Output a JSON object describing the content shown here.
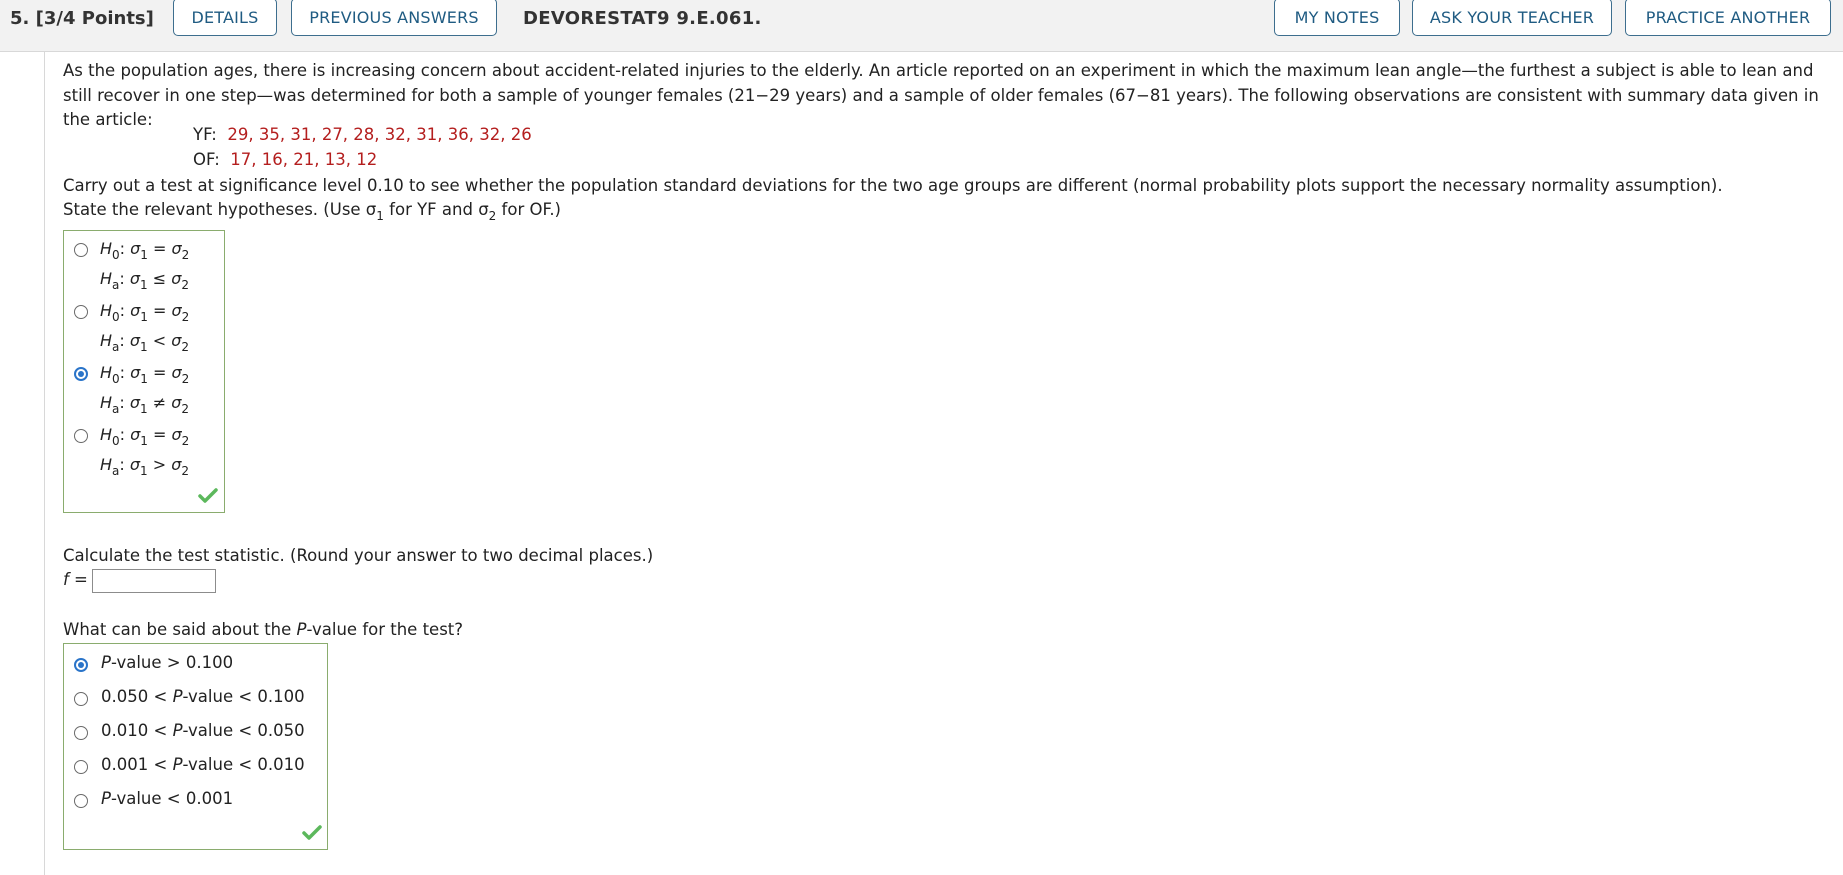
{
  "header": {
    "question_number": "5.",
    "points": "[3/4 Points]",
    "details_label": "DETAILS",
    "previous_answers_label": "PREVIOUS ANSWERS",
    "question_code": "DEVORESTAT9 9.E.061.",
    "my_notes_label": "MY NOTES",
    "ask_teacher_label": "ASK YOUR TEACHER",
    "practice_another_label": "PRACTICE ANOTHER"
  },
  "problem": {
    "intro": "As the population ages, there is increasing concern about accident-related injuries to the elderly. An article reported on an experiment in which the maximum lean angle—the furthest a subject is able to lean and still recover in one step—was determined for both a sample of younger females (21−29 years) and a sample of older females (67−81 years). The following observations are consistent with summary data given in the article:",
    "yf_label": "YF:",
    "yf_values": "29, 35, 31, 27, 28, 32, 31, 36, 32, 26",
    "of_label": "OF:",
    "of_values": "17, 16, 21, 13, 12",
    "test_instruction": "Carry out a test at significance level 0.10 to see whether the population standard deviations for the two age groups are different (normal probability plots support the necessary normality assumption).",
    "hypotheses_prompt_a": "State the relevant hypotheses. (Use σ",
    "hypotheses_prompt_sub1": "1",
    "hypotheses_prompt_b": " for YF and σ",
    "hypotheses_prompt_sub2": "2",
    "hypotheses_prompt_c": " for OF.)"
  },
  "hypotheses_options": [
    {
      "h0": "σ1 = σ2",
      "ha_op": "≤",
      "selected": false
    },
    {
      "h0": "σ1 = σ2",
      "ha_op": "<",
      "selected": false
    },
    {
      "h0": "σ1 = σ2",
      "ha_op": "≠",
      "selected": true
    },
    {
      "h0": "σ1 = σ2",
      "ha_op": ">",
      "selected": false
    }
  ],
  "test_statistic": {
    "prompt": "Calculate the test statistic. (Round your answer to two decimal places.)",
    "label": "f =",
    "value": ""
  },
  "pvalue": {
    "prompt_a": "What can be said about the ",
    "prompt_italic": "P",
    "prompt_b": "-value for the test?",
    "options": [
      {
        "pre": "",
        "mid": "P",
        "post": "-value > 0.100",
        "selected": true
      },
      {
        "pre": "0.050 < ",
        "mid": "P",
        "post": "-value < 0.100",
        "selected": false
      },
      {
        "pre": "0.010 < ",
        "mid": "P",
        "post": "-value < 0.050",
        "selected": false
      },
      {
        "pre": "0.001 < ",
        "mid": "P",
        "post": "-value < 0.010",
        "selected": false
      },
      {
        "pre": "",
        "mid": "P",
        "post": "-value < 0.001",
        "selected": false
      }
    ]
  },
  "colors": {
    "accent": "#2a74c9",
    "button_text": "#1f5b82",
    "data_red": "#b41e1e",
    "correct_green": "#5cb85c"
  },
  "icons": {
    "correct": "check-mark-icon",
    "radio": "radio-button-icon"
  }
}
